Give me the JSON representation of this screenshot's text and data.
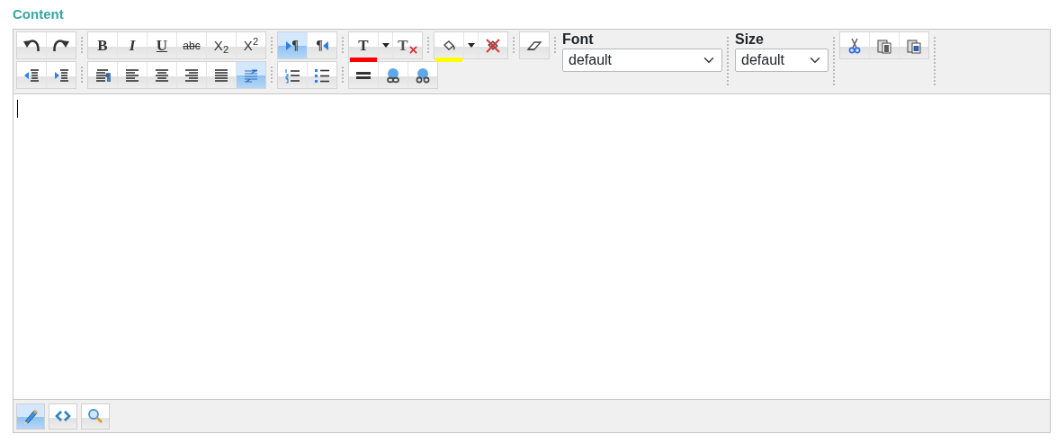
{
  "section_title": "Content",
  "toolbar": {
    "rows": [
      {
        "groups": [
          {
            "buttons": [
              {
                "kind": "undo",
                "selected": false
              },
              {
                "kind": "redo",
                "selected": false
              }
            ]
          },
          {
            "buttons": [
              {
                "kind": "bold",
                "label": "B",
                "selected": false
              },
              {
                "kind": "italic",
                "label": "I",
                "selected": false
              },
              {
                "kind": "underline",
                "label": "U",
                "selected": false
              },
              {
                "kind": "strike",
                "label": "abc",
                "selected": false
              },
              {
                "kind": "subscript",
                "label": "X$_{2}$",
                "selected": false
              },
              {
                "kind": "superscript",
                "label": "X$^{2}$",
                "selected": false
              }
            ]
          },
          {
            "buttons": [
              {
                "kind": "ltr",
                "label": "¶",
                "selected": true
              },
              {
                "kind": "rtl",
                "label": "¶",
                "selected": false
              }
            ]
          },
          {
            "buttons": [
              {
                "kind": "fore-color",
                "label": "T",
                "color": "#ff0000",
                "selected": false
              },
              {
                "kind": "dropdown",
                "selected": false
              },
              {
                "kind": "remove-fore-color",
                "label": "T",
                "selected": false
              }
            ]
          },
          {
            "buttons": [
              {
                "kind": "back-color",
                "color": "#ffff00",
                "selected": false
              },
              {
                "kind": "dropdown",
                "selected": false
              },
              {
                "kind": "remove-back-color",
                "selected": false
              }
            ]
          },
          {
            "buttons": [
              {
                "kind": "eraser",
                "selected": false
              }
            ]
          }
        ]
      },
      {
        "groups": [
          {
            "buttons": [
              {
                "kind": "outdent",
                "selected": false
              },
              {
                "kind": "indent",
                "selected": false
              }
            ]
          },
          {
            "buttons": [
              {
                "kind": "align-para",
                "selected": false
              },
              {
                "kind": "align-left",
                "selected": false
              },
              {
                "kind": "align-center",
                "selected": false
              },
              {
                "kind": "align-right",
                "selected": false
              },
              {
                "kind": "align-justify",
                "selected": false
              },
              {
                "kind": "align-none",
                "selected": true
              }
            ]
          },
          {
            "buttons": [
              {
                "kind": "ordered-list",
                "selected": false
              },
              {
                "kind": "bullet-list",
                "selected": false
              }
            ]
          },
          {
            "buttons": [
              {
                "kind": "rule",
                "selected": false
              },
              {
                "kind": "link",
                "selected": false
              },
              {
                "kind": "unlink",
                "selected": false
              }
            ]
          }
        ]
      }
    ],
    "font": {
      "label": "Font",
      "value": "default"
    },
    "size": {
      "label": "Size",
      "value": "default"
    },
    "clipboard": [
      {
        "kind": "cut",
        "selected": false
      },
      {
        "kind": "paste",
        "selected": false
      },
      {
        "kind": "paste-word",
        "selected": false
      }
    ]
  },
  "modes": [
    {
      "kind": "design",
      "selected": true
    },
    {
      "kind": "html",
      "selected": false
    },
    {
      "kind": "preview",
      "selected": false
    }
  ]
}
